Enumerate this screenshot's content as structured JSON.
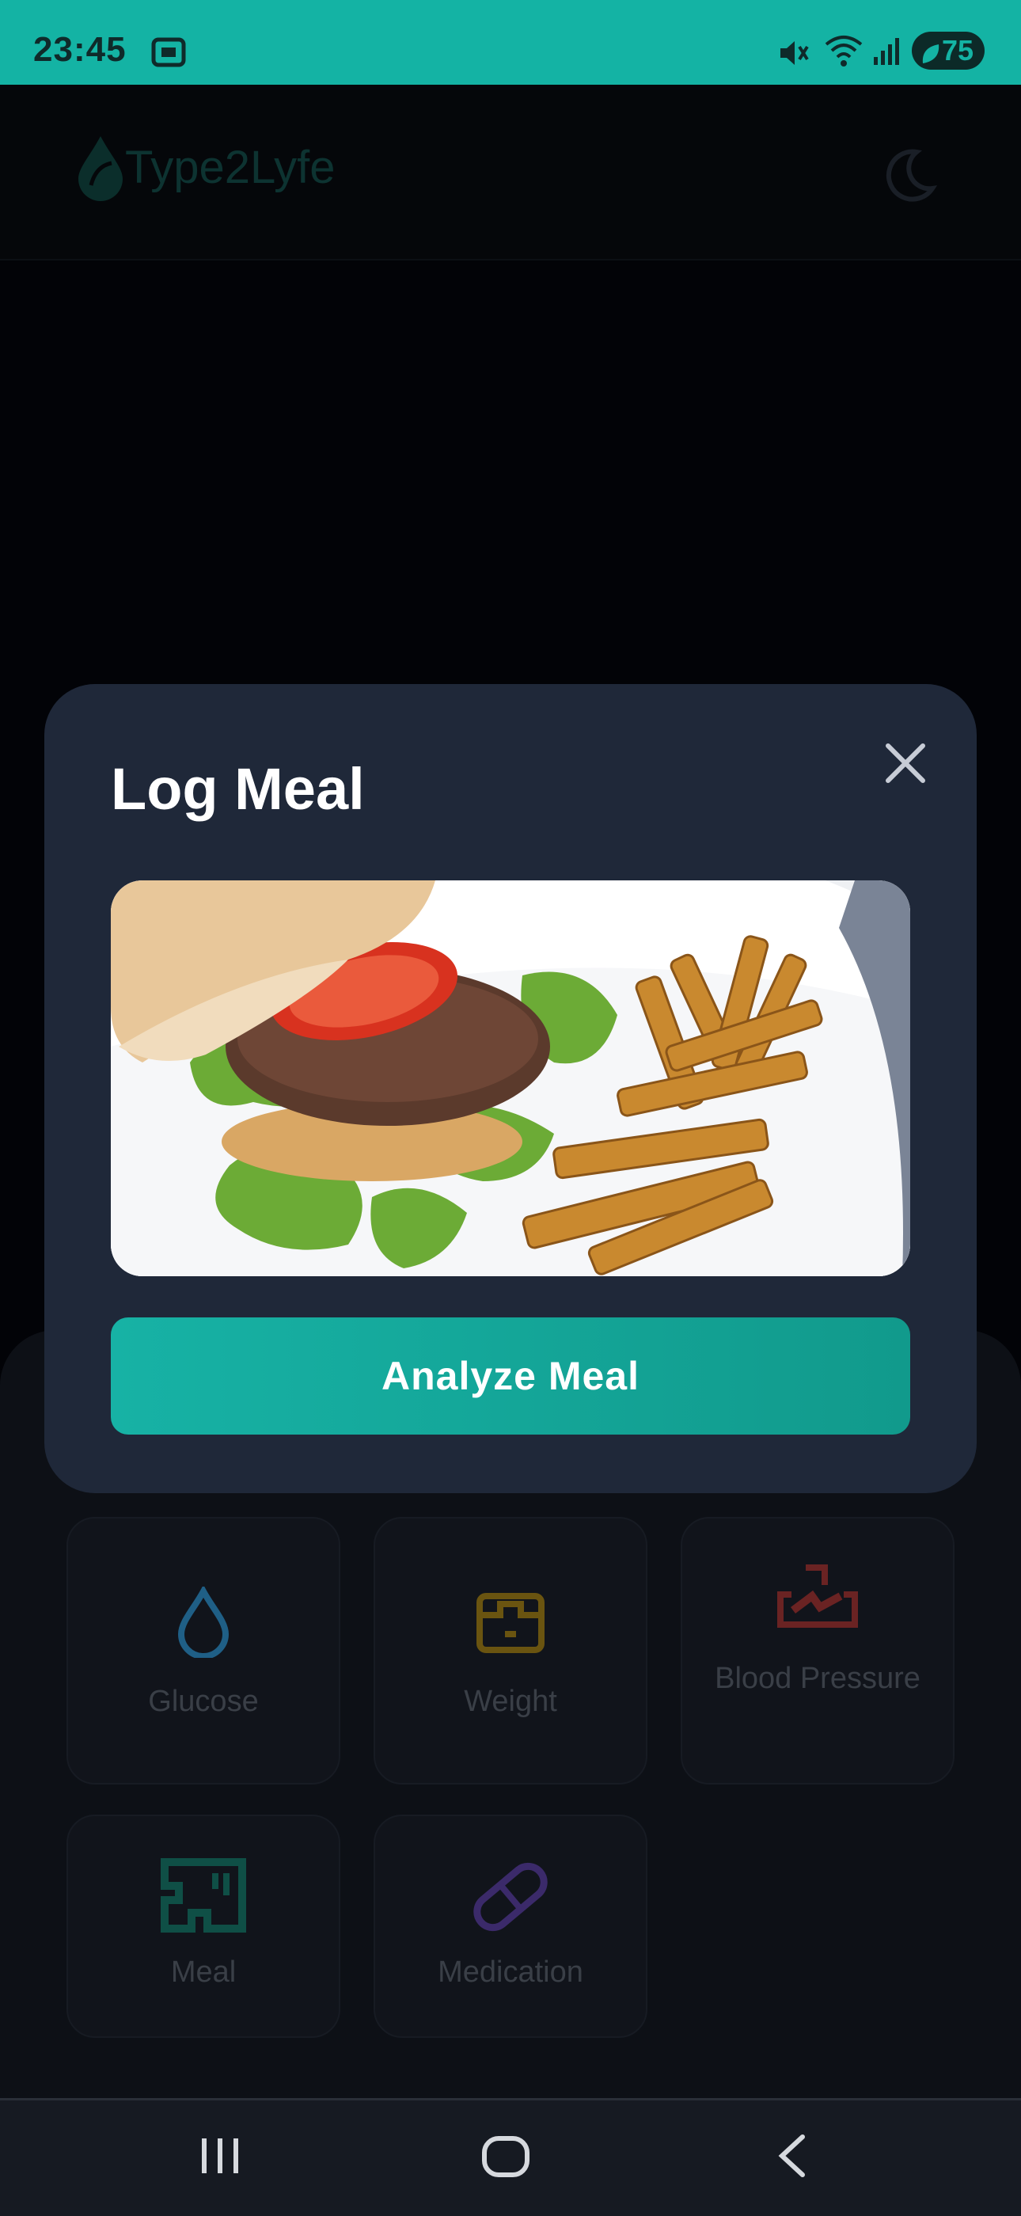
{
  "status_bar": {
    "time": "23:45",
    "battery": "75",
    "icons": [
      "screenshot-icon",
      "mute-icon",
      "wifi-icon",
      "signal-icon",
      "battery-icon"
    ]
  },
  "header": {
    "app_name": "Type2Lyfe",
    "icons": [
      "drop-leaf-logo-icon",
      "moon-icon"
    ]
  },
  "modal": {
    "title": "Log Meal",
    "photo_subject": "burger-with-fries-photo",
    "analyze_button": "Analyze Meal",
    "icons": [
      "close-icon"
    ]
  },
  "tiles": [
    {
      "label": "Glucose",
      "icon": "drop-icon",
      "color": "#1f5f86"
    },
    {
      "label": "Weight",
      "icon": "scale-icon",
      "color": "#6a5410"
    },
    {
      "label": "Blood Pressure",
      "icon": "blood-pressure-icon",
      "color": "#6a2323"
    },
    {
      "label": "Meal",
      "icon": "meal-icon",
      "color": "#0f4f46"
    },
    {
      "label": "Medication",
      "icon": "pill-icon",
      "color": "#3b2a6a"
    }
  ],
  "nav": {
    "icons": [
      "recent-apps-icon",
      "home-icon",
      "back-icon"
    ]
  },
  "colors": {
    "status_bar": "#14b3a4",
    "modal_bg": "#1f2839",
    "accent": "#17b2a5"
  }
}
